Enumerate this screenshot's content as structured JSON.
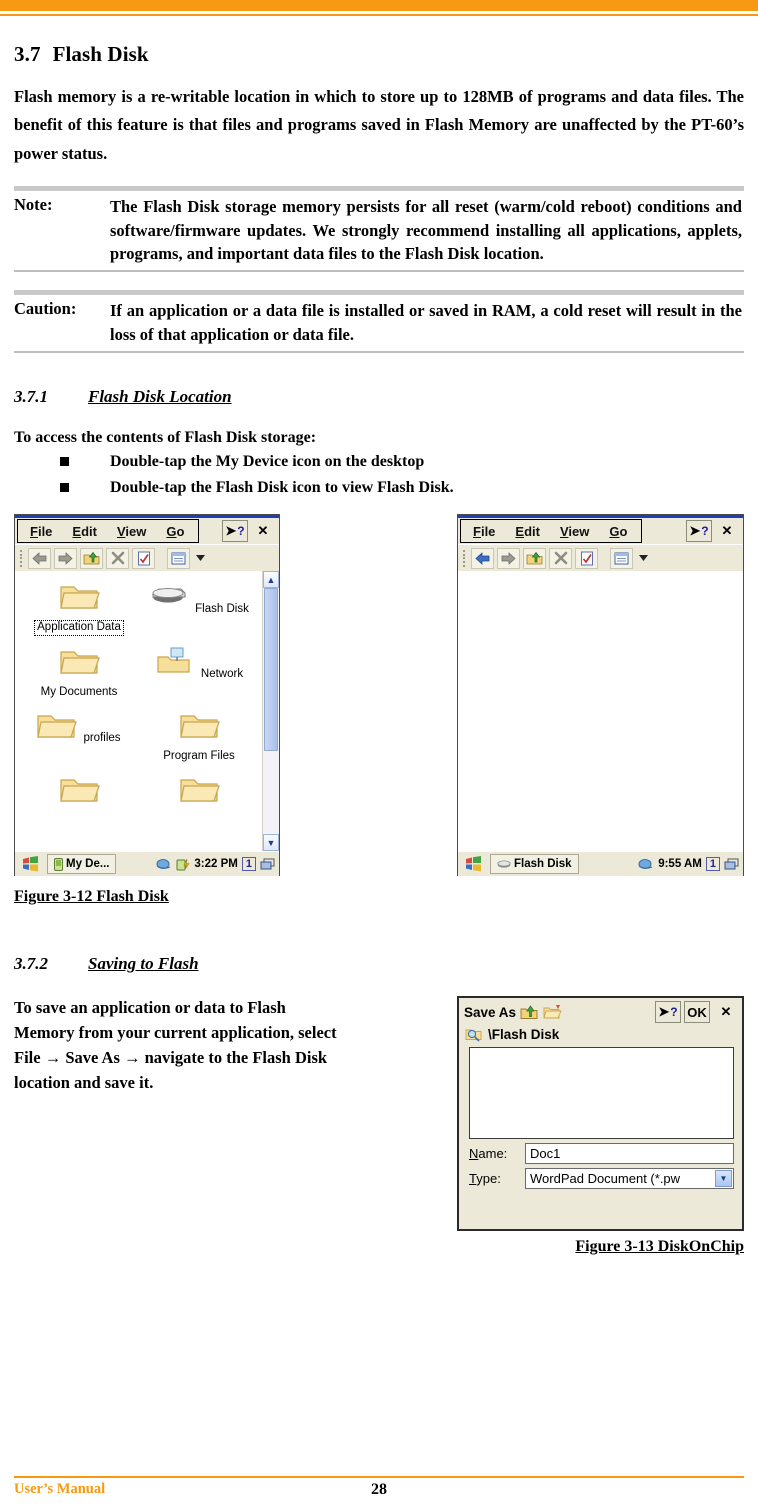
{
  "section": {
    "number": "3.7",
    "title": "Flash Disk",
    "intro": "Flash memory is a re-writable location in which to store up to 128MB of programs and data files. The benefit of this feature is that files and programs saved in Flash Memory are unaffected by the PT-60’s power status."
  },
  "note": {
    "label": "Note:",
    "text": "The Flash Disk storage memory persists for all reset (warm/cold reboot) conditions and software/firmware updates. We strongly recommend installing all applications, applets, programs, and important data files to the Flash Disk location."
  },
  "caution": {
    "label": "Caution:",
    "text": "If an application or a data file is installed or saved in RAM, a cold reset will result in the loss of that application or data file."
  },
  "subsection_1": {
    "number": "3.7.1",
    "title": "Flash Disk Location",
    "lead": "To access the contents of Flash Disk storage:",
    "bullets": [
      {
        "pre": "Double-tap the ",
        "bold1": "My Device",
        "mid": " icon on the desktop",
        "bold2": "",
        "post": ""
      },
      {
        "pre": "Double-tap the ",
        "bold1": "Flash Disk",
        "mid": " icon to view ",
        "bold2": "Flash Disk",
        "post": "."
      }
    ]
  },
  "subsection_2": {
    "number": "3.7.2",
    "title": "Saving to Flash",
    "text": "To save an application or data to Flash Memory from your current application, select File  → Save As  → navigate to the Flash Disk location and save it."
  },
  "explorer_left": {
    "menus": [
      "File",
      "Edit",
      "View",
      "Go"
    ],
    "toolbar": [
      "back-icon",
      "forward-icon",
      "up-folder-icon",
      "delete-icon",
      "properties-icon",
      "views-icon"
    ],
    "help_button": "?",
    "close_button": "×",
    "icons": [
      {
        "label": "Application Data",
        "type": "folder",
        "selected": true
      },
      {
        "label": "Flash Disk",
        "type": "disk",
        "selected": false
      },
      {
        "label": "My Documents",
        "type": "folder",
        "selected": false
      },
      {
        "label": "Network",
        "type": "network",
        "selected": false
      },
      {
        "label": "profiles",
        "type": "folder",
        "selected": false
      },
      {
        "label": "Program Files",
        "type": "folder",
        "selected": false
      },
      {
        "label": "",
        "type": "folder",
        "selected": false
      },
      {
        "label": "",
        "type": "folder",
        "selected": false
      }
    ],
    "taskbar": {
      "task": "My De...",
      "time": "3:22 PM",
      "count": "1"
    }
  },
  "explorer_right": {
    "menus": [
      "File",
      "Edit",
      "View",
      "Go"
    ],
    "help_button": "?",
    "close_button": "×",
    "taskbar": {
      "task": "Flash Disk",
      "time": "9:55 AM",
      "count": "1"
    }
  },
  "figure_12": {
    "caption": "Figure 3-12 Flash Disk"
  },
  "figure_13": {
    "caption": "Figure 3-13 DiskOnChip"
  },
  "save_as": {
    "title": "Save As",
    "ok_button": "OK",
    "close_button": "×",
    "help_button": "?",
    "path": "\\Flash Disk",
    "name_label": "Name:",
    "name_value": "Doc1",
    "type_label": "Type:",
    "type_value": "WordPad Document (*.pw"
  },
  "footer": {
    "left": "User’s Manual",
    "page": "28"
  },
  "colors": {
    "accent": "#F79A11",
    "title_bar": "#1a3fbf",
    "window_face": "#ECE9D8"
  }
}
